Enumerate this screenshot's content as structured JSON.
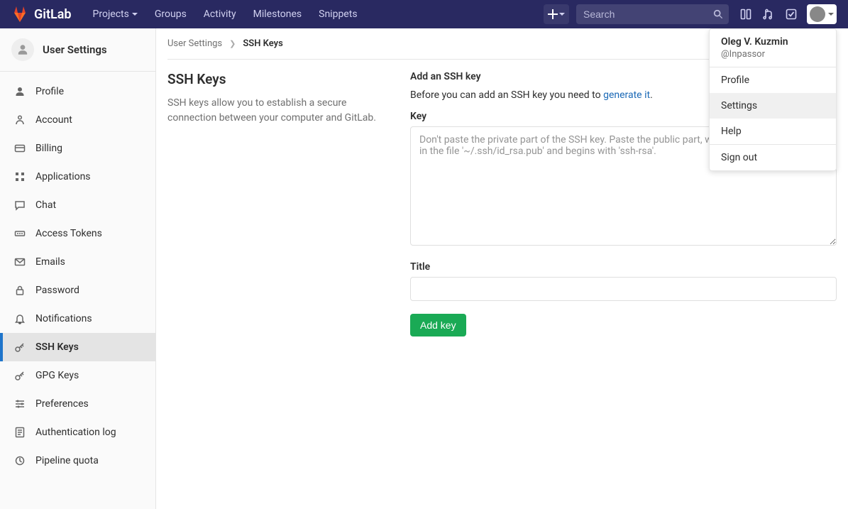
{
  "brand": "GitLab",
  "topnav": {
    "links": [
      "Projects",
      "Groups",
      "Activity",
      "Milestones",
      "Snippets"
    ],
    "search_placeholder": "Search"
  },
  "user_dropdown": {
    "name": "Oleg V. Kuzmin",
    "handle": "@Inpassor",
    "items": [
      "Profile",
      "Settings",
      "Help"
    ],
    "signout": "Sign out",
    "active_index": 1
  },
  "sidebar": {
    "title": "User Settings",
    "items": [
      {
        "label": "Profile",
        "icon": "user"
      },
      {
        "label": "Account",
        "icon": "account"
      },
      {
        "label": "Billing",
        "icon": "card"
      },
      {
        "label": "Applications",
        "icon": "apps"
      },
      {
        "label": "Chat",
        "icon": "chat"
      },
      {
        "label": "Access Tokens",
        "icon": "token"
      },
      {
        "label": "Emails",
        "icon": "mail"
      },
      {
        "label": "Password",
        "icon": "lock"
      },
      {
        "label": "Notifications",
        "icon": "bell"
      },
      {
        "label": "SSH Keys",
        "icon": "key",
        "active": true
      },
      {
        "label": "GPG Keys",
        "icon": "key"
      },
      {
        "label": "Preferences",
        "icon": "prefs"
      },
      {
        "label": "Authentication log",
        "icon": "log"
      },
      {
        "label": "Pipeline quota",
        "icon": "pipeline"
      }
    ]
  },
  "breadcrumb": {
    "parent": "User Settings",
    "current": "SSH Keys"
  },
  "page": {
    "title": "SSH Keys",
    "desc": "SSH keys allow you to establish a secure connection between your computer and GitLab.",
    "form": {
      "heading": "Add an SSH key",
      "intro_pre": "Before you can add an SSH key you need to ",
      "intro_link": "generate it",
      "intro_post": ".",
      "key_label": "Key",
      "key_placeholder": "Don't paste the private part of the SSH key. Paste the public part, which is usually contained in the file '~/.ssh/id_rsa.pub' and begins with 'ssh-rsa'.",
      "title_label": "Title",
      "submit": "Add key"
    }
  }
}
